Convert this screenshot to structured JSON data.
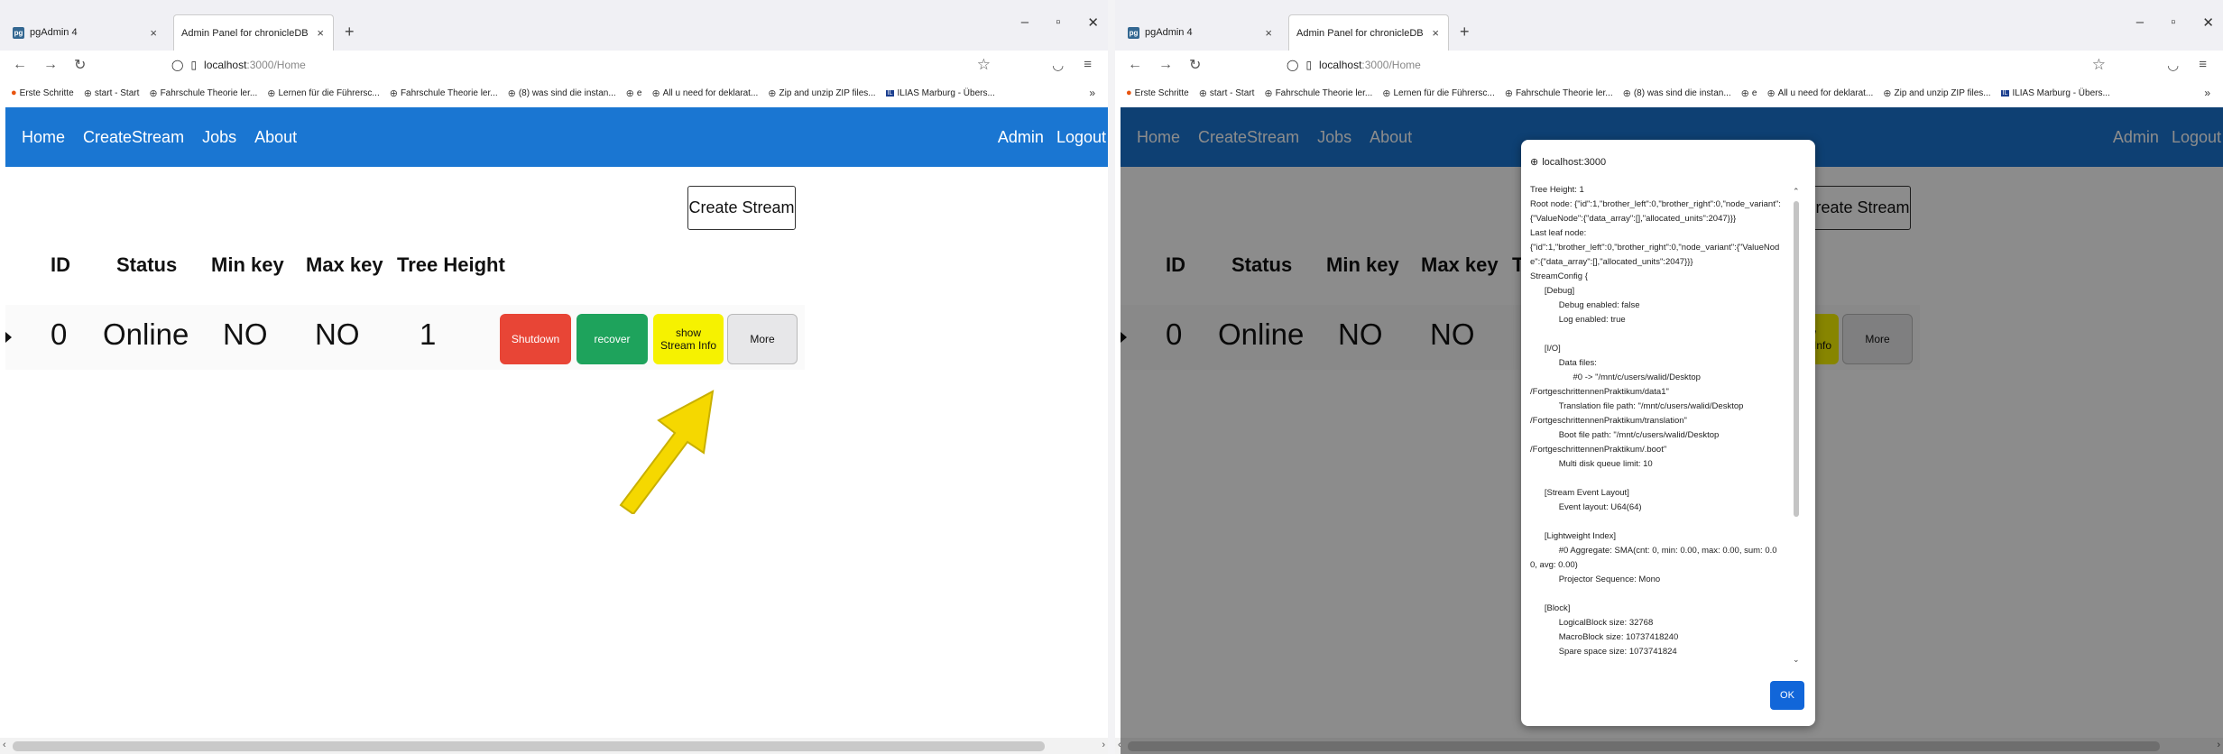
{
  "browser": {
    "tabs": [
      {
        "icon": "pg",
        "title": "pgAdmin 4"
      },
      {
        "title": "Admin Panel for chronicleDB"
      }
    ],
    "url_host": "localhost",
    "url_rest": ":3000/Home",
    "nav_icons": [
      "back-arrow-icon",
      "forward-arrow-icon",
      "reload-icon"
    ],
    "bookmarks": [
      "Erste Schritte",
      "start - Start",
      "Fahrschule Theorie ler...",
      "Lernen für die Führersc...",
      "Fahrschule Theorie ler...",
      "(8) was sind die instan...",
      "e",
      "All u need for deklarat...",
      "Zip and unzip ZIP files...",
      "ILIAS Marburg - Übers..."
    ]
  },
  "app": {
    "nav_links": [
      "Home",
      "CreateStream",
      "Jobs",
      "About"
    ],
    "nav_right": [
      "Admin",
      "Logout"
    ],
    "create_stream_label": "Create Stream",
    "table": {
      "headers": [
        "ID",
        "Status",
        "Min key",
        "Max key",
        "Tree Height"
      ],
      "row": {
        "id": "0",
        "status": "Online",
        "min_key": "NO",
        "max_key": "NO",
        "tree_height": "1"
      },
      "actions": {
        "shutdown": "Shutdown",
        "recover": "recover",
        "show_info": "show Stream Info",
        "more": "More"
      }
    }
  },
  "dialog": {
    "origin": "localhost:3000",
    "text": "Tree Height: 1\nRoot node: {\"id\":1,\"brother_left\":0,\"brother_right\":0,\"node_variant\":{\"ValueNode\":{\"data_array\":[],\"allocated_units\":2047}}}\nLast leaf node:\n{\"id\":1,\"brother_left\":0,\"brother_right\":0,\"node_variant\":{\"ValueNode\":{\"data_array\":[],\"allocated_units\":2047}}}\nStreamConfig {\n      [Debug]\n            Debug enabled: false\n            Log enabled: true\n\n      [I/O]\n            Data files:\n                  #0 -> \"/mnt/c/users/walid/Desktop\n/FortgeschrittennenPraktikum/data1\"\n            Translation file path: \"/mnt/c/users/walid/Desktop\n/FortgeschrittennenPraktikum/translation\"\n            Boot file path: \"/mnt/c/users/walid/Desktop\n/FortgeschrittennenPraktikum/.boot\"\n            Multi disk queue limit: 10\n\n      [Stream Event Layout]\n            Event layout: U64(64)\n\n      [Lightweight Index]\n            #0 Aggregate: SMA(cnt: 0, min: 0.00, max: 0.00, sum: 0.00, avg: 0.00)\n            Projector Sequence: Mono\n\n      [Block]\n            LogicalBlock size: 32768\n            MacroBlock size: 10737418240\n            Spare space size: 1073741824",
    "ok_label": "OK"
  },
  "colors": {
    "navbar": "#1a76d2",
    "shutdown": "#e84536",
    "recover": "#1ea35c",
    "show_info": "#f6f200",
    "annotation_arrow": "#f5d800"
  }
}
